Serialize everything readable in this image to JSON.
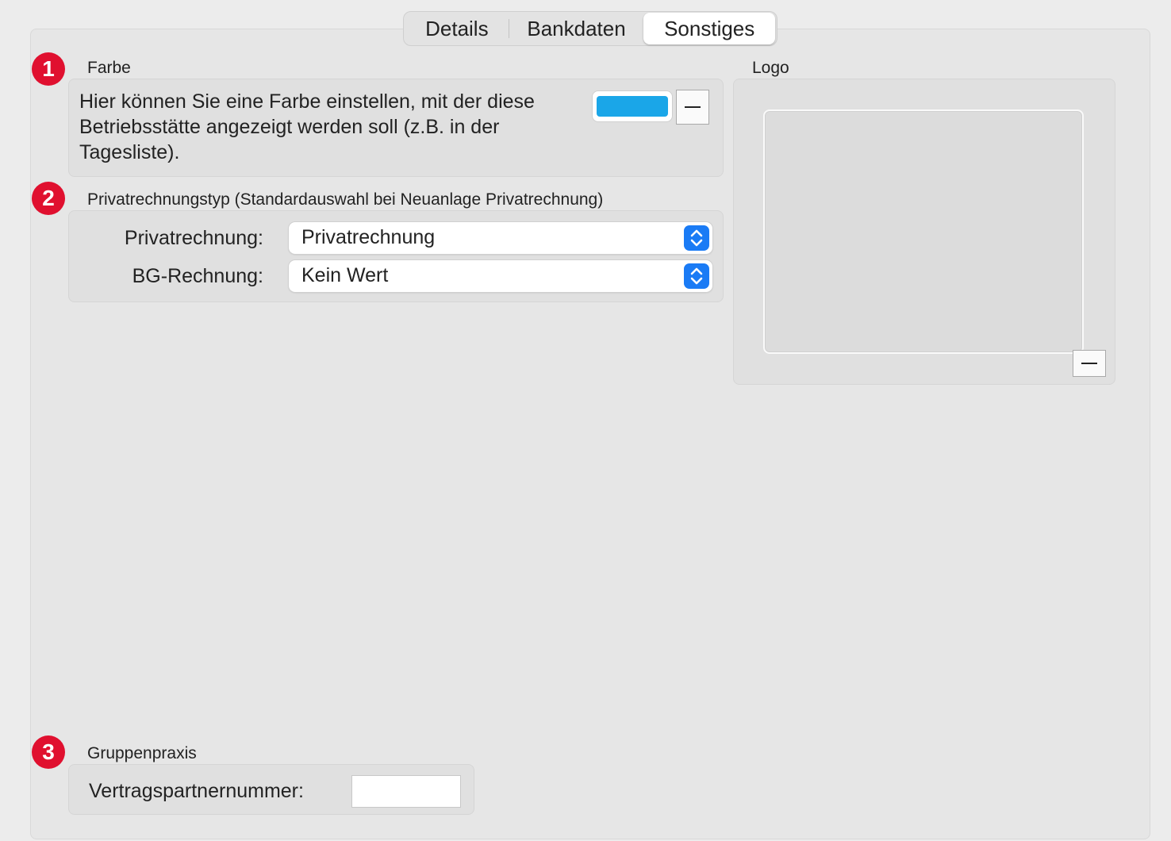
{
  "tabs": [
    {
      "label": "Details",
      "selected": false
    },
    {
      "label": "Bankdaten",
      "selected": false
    },
    {
      "label": "Sonstiges",
      "selected": true
    }
  ],
  "farbe": {
    "badge": "1",
    "title": "Farbe",
    "description": "Hier können Sie eine Farbe einstellen, mit der diese Betriebsstätte angezeigt werden soll (z.B. in der Tagesliste).",
    "color": "#1aa6e8"
  },
  "privatrechnungstyp": {
    "badge": "2",
    "title": "Privatrechnungstyp (Standardauswahl bei Neuanlage Privatrechnung)",
    "privatrechnung_label": "Privatrechnung:",
    "privatrechnung_value": "Privatrechnung",
    "bg_label": "BG-Rechnung:",
    "bg_value": "Kein Wert"
  },
  "logo": {
    "title": "Logo"
  },
  "gruppenpraxis": {
    "badge": "3",
    "title": "Gruppenpraxis",
    "vertragspartner_label": "Vertragspartnernummer:",
    "vertragspartner_value": ""
  }
}
